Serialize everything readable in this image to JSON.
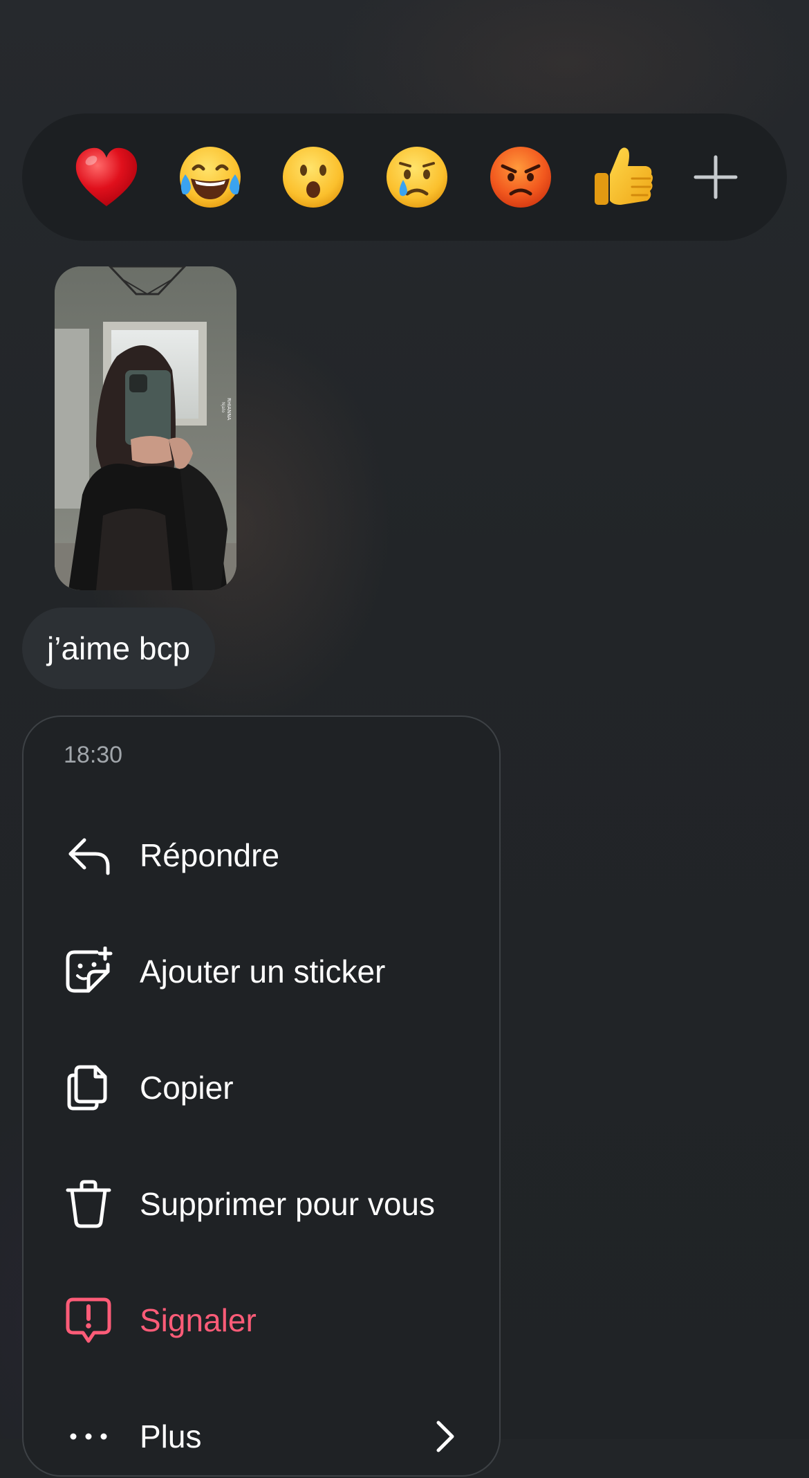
{
  "reactions": [
    {
      "emoji": "❤️",
      "icon": "red-heart-icon"
    },
    {
      "emoji": "😂",
      "icon": "face-with-tears-of-joy-icon"
    },
    {
      "emoji": "😮",
      "icon": "face-with-open-mouth-icon"
    },
    {
      "emoji": "😢",
      "icon": "crying-face-icon"
    },
    {
      "emoji": "😡",
      "icon": "angry-face-icon"
    },
    {
      "emoji": "👍",
      "icon": "thumbs-up-icon"
    }
  ],
  "reaction_more_icon": "plus-icon",
  "message": {
    "photo_watermark": "RHIANNA\nNjalo",
    "text": "j’aime bcp"
  },
  "menu": {
    "time": "18:30",
    "items": [
      {
        "label": "Répondre",
        "icon": "reply-icon"
      },
      {
        "label": "Ajouter un sticker",
        "icon": "add-sticker-icon"
      },
      {
        "label": "Copier",
        "icon": "copy-icon"
      },
      {
        "label": "Supprimer pour vous",
        "icon": "trash-icon"
      },
      {
        "label": "Signaler",
        "icon": "report-icon",
        "color": "#ff5c78"
      },
      {
        "label": "Plus",
        "icon": "more-icon"
      }
    ]
  },
  "colors": {
    "background": "#222528",
    "menu_background": "#1f2225",
    "bubble": "#2c3034",
    "danger": "#ff5c78"
  }
}
